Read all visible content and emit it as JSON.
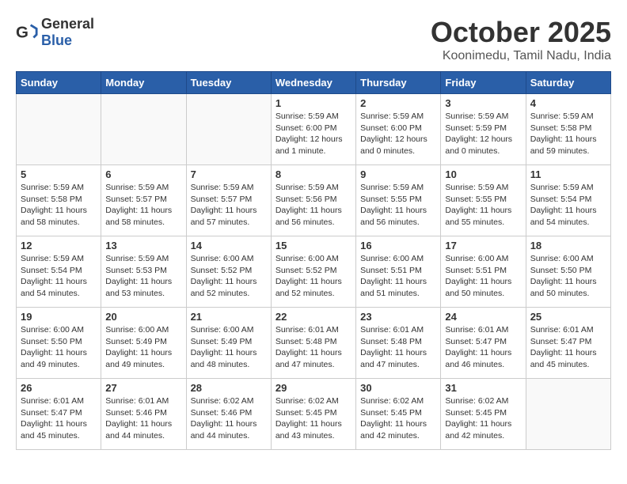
{
  "header": {
    "logo_general": "General",
    "logo_blue": "Blue",
    "month": "October 2025",
    "location": "Koonimedu, Tamil Nadu, India"
  },
  "days_of_week": [
    "Sunday",
    "Monday",
    "Tuesday",
    "Wednesday",
    "Thursday",
    "Friday",
    "Saturday"
  ],
  "weeks": [
    [
      {
        "day": "",
        "sunrise": "",
        "sunset": "",
        "daylight": ""
      },
      {
        "day": "",
        "sunrise": "",
        "sunset": "",
        "daylight": ""
      },
      {
        "day": "",
        "sunrise": "",
        "sunset": "",
        "daylight": ""
      },
      {
        "day": "1",
        "sunrise": "Sunrise: 5:59 AM",
        "sunset": "Sunset: 6:00 PM",
        "daylight": "Daylight: 12 hours and 1 minute."
      },
      {
        "day": "2",
        "sunrise": "Sunrise: 5:59 AM",
        "sunset": "Sunset: 6:00 PM",
        "daylight": "Daylight: 12 hours and 0 minutes."
      },
      {
        "day": "3",
        "sunrise": "Sunrise: 5:59 AM",
        "sunset": "Sunset: 5:59 PM",
        "daylight": "Daylight: 12 hours and 0 minutes."
      },
      {
        "day": "4",
        "sunrise": "Sunrise: 5:59 AM",
        "sunset": "Sunset: 5:58 PM",
        "daylight": "Daylight: 11 hours and 59 minutes."
      }
    ],
    [
      {
        "day": "5",
        "sunrise": "Sunrise: 5:59 AM",
        "sunset": "Sunset: 5:58 PM",
        "daylight": "Daylight: 11 hours and 58 minutes."
      },
      {
        "day": "6",
        "sunrise": "Sunrise: 5:59 AM",
        "sunset": "Sunset: 5:57 PM",
        "daylight": "Daylight: 11 hours and 58 minutes."
      },
      {
        "day": "7",
        "sunrise": "Sunrise: 5:59 AM",
        "sunset": "Sunset: 5:57 PM",
        "daylight": "Daylight: 11 hours and 57 minutes."
      },
      {
        "day": "8",
        "sunrise": "Sunrise: 5:59 AM",
        "sunset": "Sunset: 5:56 PM",
        "daylight": "Daylight: 11 hours and 56 minutes."
      },
      {
        "day": "9",
        "sunrise": "Sunrise: 5:59 AM",
        "sunset": "Sunset: 5:55 PM",
        "daylight": "Daylight: 11 hours and 56 minutes."
      },
      {
        "day": "10",
        "sunrise": "Sunrise: 5:59 AM",
        "sunset": "Sunset: 5:55 PM",
        "daylight": "Daylight: 11 hours and 55 minutes."
      },
      {
        "day": "11",
        "sunrise": "Sunrise: 5:59 AM",
        "sunset": "Sunset: 5:54 PM",
        "daylight": "Daylight: 11 hours and 54 minutes."
      }
    ],
    [
      {
        "day": "12",
        "sunrise": "Sunrise: 5:59 AM",
        "sunset": "Sunset: 5:54 PM",
        "daylight": "Daylight: 11 hours and 54 minutes."
      },
      {
        "day": "13",
        "sunrise": "Sunrise: 5:59 AM",
        "sunset": "Sunset: 5:53 PM",
        "daylight": "Daylight: 11 hours and 53 minutes."
      },
      {
        "day": "14",
        "sunrise": "Sunrise: 6:00 AM",
        "sunset": "Sunset: 5:52 PM",
        "daylight": "Daylight: 11 hours and 52 minutes."
      },
      {
        "day": "15",
        "sunrise": "Sunrise: 6:00 AM",
        "sunset": "Sunset: 5:52 PM",
        "daylight": "Daylight: 11 hours and 52 minutes."
      },
      {
        "day": "16",
        "sunrise": "Sunrise: 6:00 AM",
        "sunset": "Sunset: 5:51 PM",
        "daylight": "Daylight: 11 hours and 51 minutes."
      },
      {
        "day": "17",
        "sunrise": "Sunrise: 6:00 AM",
        "sunset": "Sunset: 5:51 PM",
        "daylight": "Daylight: 11 hours and 50 minutes."
      },
      {
        "day": "18",
        "sunrise": "Sunrise: 6:00 AM",
        "sunset": "Sunset: 5:50 PM",
        "daylight": "Daylight: 11 hours and 50 minutes."
      }
    ],
    [
      {
        "day": "19",
        "sunrise": "Sunrise: 6:00 AM",
        "sunset": "Sunset: 5:50 PM",
        "daylight": "Daylight: 11 hours and 49 minutes."
      },
      {
        "day": "20",
        "sunrise": "Sunrise: 6:00 AM",
        "sunset": "Sunset: 5:49 PM",
        "daylight": "Daylight: 11 hours and 49 minutes."
      },
      {
        "day": "21",
        "sunrise": "Sunrise: 6:00 AM",
        "sunset": "Sunset: 5:49 PM",
        "daylight": "Daylight: 11 hours and 48 minutes."
      },
      {
        "day": "22",
        "sunrise": "Sunrise: 6:01 AM",
        "sunset": "Sunset: 5:48 PM",
        "daylight": "Daylight: 11 hours and 47 minutes."
      },
      {
        "day": "23",
        "sunrise": "Sunrise: 6:01 AM",
        "sunset": "Sunset: 5:48 PM",
        "daylight": "Daylight: 11 hours and 47 minutes."
      },
      {
        "day": "24",
        "sunrise": "Sunrise: 6:01 AM",
        "sunset": "Sunset: 5:47 PM",
        "daylight": "Daylight: 11 hours and 46 minutes."
      },
      {
        "day": "25",
        "sunrise": "Sunrise: 6:01 AM",
        "sunset": "Sunset: 5:47 PM",
        "daylight": "Daylight: 11 hours and 45 minutes."
      }
    ],
    [
      {
        "day": "26",
        "sunrise": "Sunrise: 6:01 AM",
        "sunset": "Sunset: 5:47 PM",
        "daylight": "Daylight: 11 hours and 45 minutes."
      },
      {
        "day": "27",
        "sunrise": "Sunrise: 6:01 AM",
        "sunset": "Sunset: 5:46 PM",
        "daylight": "Daylight: 11 hours and 44 minutes."
      },
      {
        "day": "28",
        "sunrise": "Sunrise: 6:02 AM",
        "sunset": "Sunset: 5:46 PM",
        "daylight": "Daylight: 11 hours and 44 minutes."
      },
      {
        "day": "29",
        "sunrise": "Sunrise: 6:02 AM",
        "sunset": "Sunset: 5:45 PM",
        "daylight": "Daylight: 11 hours and 43 minutes."
      },
      {
        "day": "30",
        "sunrise": "Sunrise: 6:02 AM",
        "sunset": "Sunset: 5:45 PM",
        "daylight": "Daylight: 11 hours and 42 minutes."
      },
      {
        "day": "31",
        "sunrise": "Sunrise: 6:02 AM",
        "sunset": "Sunset: 5:45 PM",
        "daylight": "Daylight: 11 hours and 42 minutes."
      },
      {
        "day": "",
        "sunrise": "",
        "sunset": "",
        "daylight": ""
      }
    ]
  ]
}
